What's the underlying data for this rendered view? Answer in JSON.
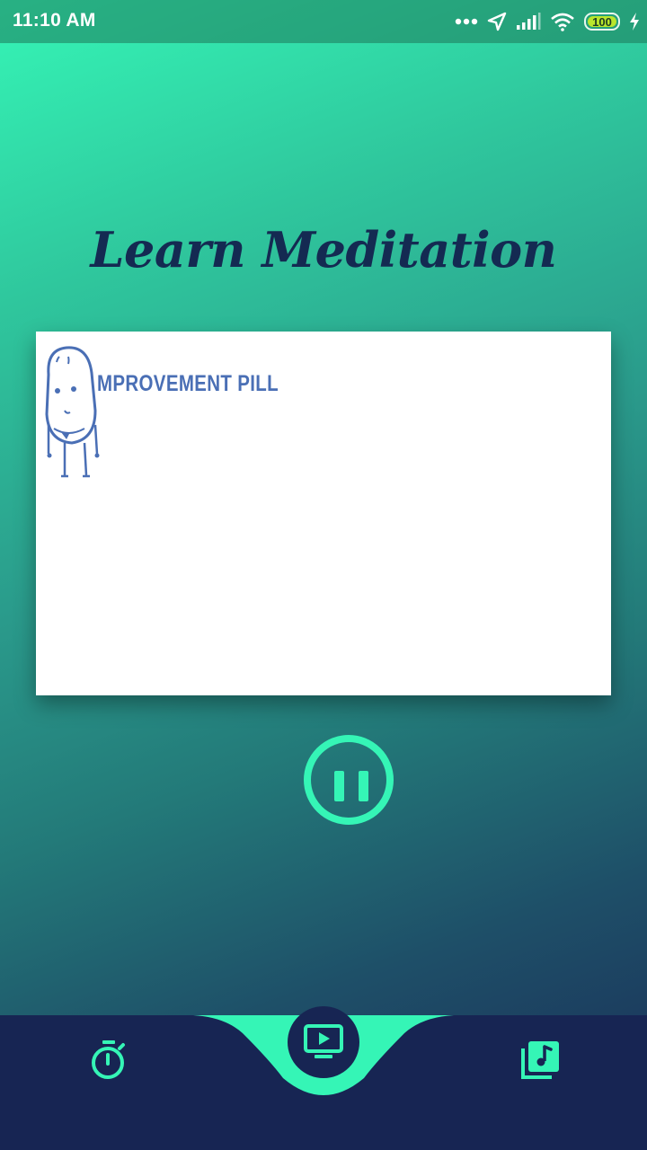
{
  "status_bar": {
    "time": "11:10 AM",
    "battery_level": "100",
    "icons": [
      "more-dots-icon",
      "location-arrow-icon",
      "signal-bars-icon",
      "wifi-icon",
      "battery-icon",
      "charging-bolt-icon"
    ]
  },
  "main": {
    "title": "Learn Meditation",
    "video": {
      "caption_text": "MPROVEMENT PILL"
    },
    "playback": {
      "state": "playing",
      "control_icon": "pause-icon"
    }
  },
  "bottom_nav": {
    "items": [
      {
        "icon": "stopwatch-icon"
      },
      {
        "icon": "video-player-icon",
        "active": true
      },
      {
        "icon": "music-library-icon"
      }
    ]
  },
  "colors": {
    "accent": "#35f5b6",
    "title": "#142a52",
    "nav_background": "#172553",
    "video_text": "#4a6fb5"
  }
}
